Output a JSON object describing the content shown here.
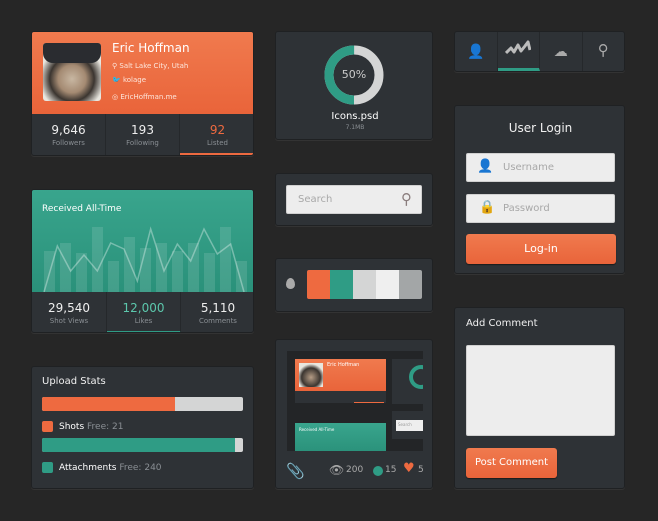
{
  "colors": {
    "accent_orange": "#ee6a40",
    "accent_teal": "#2f9c85",
    "background": "#262626",
    "card": "#2e3236"
  },
  "profile": {
    "name": "Eric Hoffman",
    "location": "Salt Lake City, Utah",
    "twitter": "kolage",
    "website": "EricHoffman.me",
    "icons": [
      "location-pin-icon",
      "twitter-icon",
      "globe-icon"
    ],
    "stats": [
      {
        "value": "9,646",
        "label": "Followers"
      },
      {
        "value": "193",
        "label": "Following"
      },
      {
        "value": "92",
        "label": "Listed",
        "active": true
      }
    ]
  },
  "received": {
    "title": "Received All-Time",
    "stats": [
      {
        "value": "29,540",
        "label": "Shot Views"
      },
      {
        "value": "12,000",
        "label": "Likes",
        "active": true
      },
      {
        "value": "5,110",
        "label": "Comments"
      }
    ]
  },
  "chart_data": {
    "type": "bar",
    "bars": [
      41,
      49,
      39,
      65,
      31,
      55,
      44,
      49,
      41,
      49,
      39,
      65,
      31
    ],
    "line": [
      0,
      46,
      21,
      37,
      21,
      49,
      43,
      11,
      63,
      21,
      48,
      31,
      63,
      38,
      48,
      0
    ]
  },
  "upload": {
    "title": "Upload Stats",
    "items": [
      {
        "name": "Shots",
        "free_label": "Free:",
        "free": "21",
        "percent": 66,
        "color": "#ee6a40"
      },
      {
        "name": "Attachments",
        "free_label": "Free:",
        "free": "240",
        "percent": 96,
        "color": "#2f9c85"
      }
    ]
  },
  "file": {
    "percent": 50,
    "percent_label": "50%",
    "name": "Icons.psd",
    "size": "7.1MB"
  },
  "search": {
    "placeholder": "Search",
    "icon": "search-icon"
  },
  "palette": {
    "icon": "droplet-icon",
    "swatches": [
      "#ee6a40",
      "#2f9c85",
      "#d4d5d5",
      "#efefef",
      "#a3a6a7"
    ]
  },
  "preview": {
    "views": "200",
    "comments": "15",
    "likes": "5"
  },
  "nav": {
    "items": [
      "user-icon",
      "activity-icon",
      "cloud-upload-icon",
      "search-icon"
    ],
    "active": 1
  },
  "login": {
    "title": "User Login",
    "username_placeholder": "Username",
    "password_placeholder": "Password",
    "button": "Log-in"
  },
  "comment": {
    "title": "Add Comment",
    "button": "Post Comment",
    "value": ""
  }
}
